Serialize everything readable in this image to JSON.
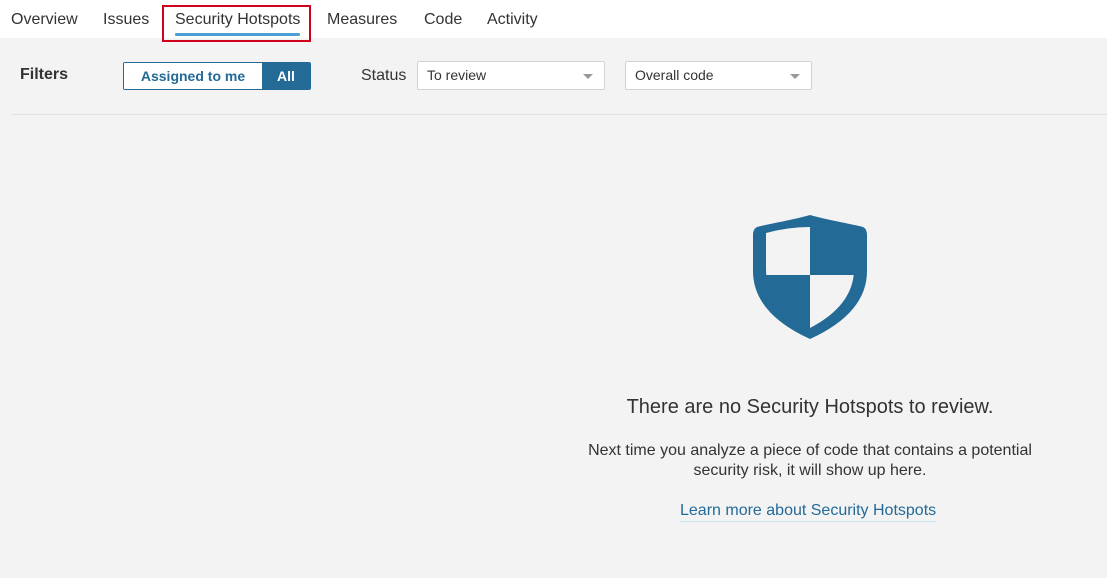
{
  "tabs": {
    "overview": "Overview",
    "issues": "Issues",
    "security_hotspots": "Security Hotspots",
    "measures": "Measures",
    "code": "Code",
    "activity": "Activity"
  },
  "filters": {
    "title": "Filters",
    "assigned_to_me": "Assigned to me",
    "all": "All",
    "status_label": "Status",
    "status_value": "To review",
    "scope_value": "Overall code"
  },
  "empty_state": {
    "icon": "shield-icon",
    "title": "There are no Security Hotspots to review.",
    "text": "Next time you analyze a piece of code that contains a potential security risk, it will show up here.",
    "link": "Learn more about Security Hotspots"
  },
  "colors": {
    "accent": "#236a97",
    "highlight": "#d0021b",
    "tab_underline": "#4b9fd5"
  }
}
